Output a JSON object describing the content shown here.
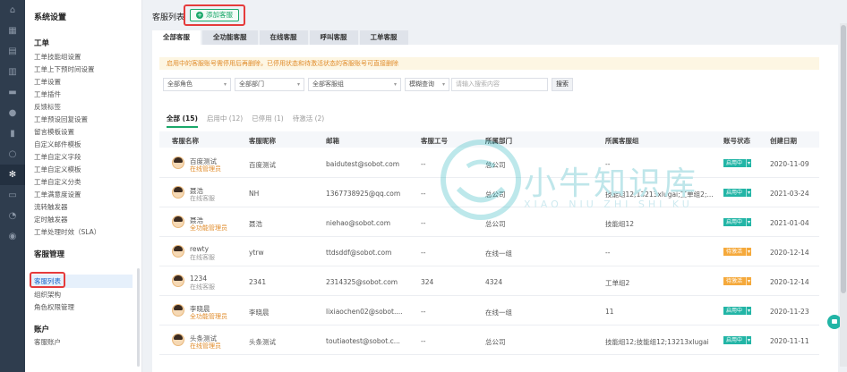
{
  "sidebar": {
    "title": "系统设置",
    "groups": [
      {
        "label": "工单"
      },
      {
        "label": "客服管理"
      },
      {
        "label": "账户"
      }
    ],
    "items": [
      "工单技能组设置",
      "工单上下预时间设置",
      "工单设置",
      "工单插件",
      "反馈标签",
      "工单预设回复设置",
      "留言模板设置",
      "自定义邮件模板",
      "工单自定义字段",
      "工单自定义模板",
      "工单自定义分类",
      "工单满意度设置",
      "流转触发器",
      "定时触发器",
      "工单处理时效（SLA）",
      "客服列表",
      "组织架构",
      "角色权限管理",
      "客服账户"
    ]
  },
  "page": {
    "title": "客服列表",
    "add_button": "添加客服"
  },
  "tabs": [
    "全部客服",
    "全功能客服",
    "在线客服",
    "呼叫客服",
    "工单客服"
  ],
  "notice": "启用中的客服账号需停用后再删除，已停用状态和待激活状态的客服账号可直接删除",
  "filters": {
    "role": "全部角色",
    "dept": "全部部门",
    "group": "全部客服组",
    "match": "模糊查询",
    "search_placeholder": "请输入搜索内容",
    "search_button": "搜索"
  },
  "subtabs": [
    "全部 (15)",
    "启用中 (12)",
    "已停用 (1)",
    "待激活 (2)"
  ],
  "table": {
    "headers": [
      "客服名称",
      "客服昵称",
      "邮箱",
      "客服工号",
      "所属部门",
      "所属客服组",
      "账号状态",
      "创建日期"
    ],
    "rows": [
      {
        "name": "百度测试",
        "role": "在线管理员",
        "nick": "百度测试",
        "email": "baidutest@sobot.com",
        "no": "--",
        "dept": "总公司",
        "group": "--",
        "status": "启用中",
        "date": "2020-11-09"
      },
      {
        "name": "聂浩",
        "role": "在线客服",
        "nick": "NH",
        "email": "1367738925@qq.com",
        "no": "--",
        "dept": "总公司",
        "group": "技能组12;13213xlugai;工单组2;...",
        "status": "启用中",
        "date": "2021-03-24"
      },
      {
        "name": "聂浩",
        "role": "全功能管理员",
        "nick": "聂浩",
        "email": "niehao@sobot.com",
        "no": "--",
        "dept": "总公司",
        "group": "技能组12",
        "status": "启用中",
        "date": "2021-01-04"
      },
      {
        "name": "rewty",
        "role": "在线客服",
        "nick": "ytrw",
        "email": "ttdsddf@sobot.com",
        "no": "--",
        "dept": "在线一组",
        "group": "--",
        "status": "待激活",
        "date": "2020-12-14"
      },
      {
        "name": "1234",
        "role": "在线客服",
        "nick": "2341",
        "email": "2314325@sobot.com",
        "no": "324",
        "dept": "4324",
        "group": "工单组2",
        "status": "待激活",
        "date": "2020-12-14"
      },
      {
        "name": "李晓晨",
        "role": "全功能管理员",
        "nick": "李晓晨",
        "email": "lixiaochen02@sobot....",
        "no": "--",
        "dept": "在线一组",
        "group": "11",
        "status": "启用中",
        "date": "2020-11-23"
      },
      {
        "name": "头条测试",
        "role": "在线管理员",
        "nick": "头条测试",
        "email": "toutiaotest@sobot.c...",
        "no": "--",
        "dept": "总公司",
        "group": "技能组12;技能组12;13213xlugai",
        "status": "启用中",
        "date": "2020-11-11"
      }
    ]
  },
  "watermark": {
    "main": "小牛知识库",
    "sub": "XIAO NIU ZHI SHI KU"
  }
}
